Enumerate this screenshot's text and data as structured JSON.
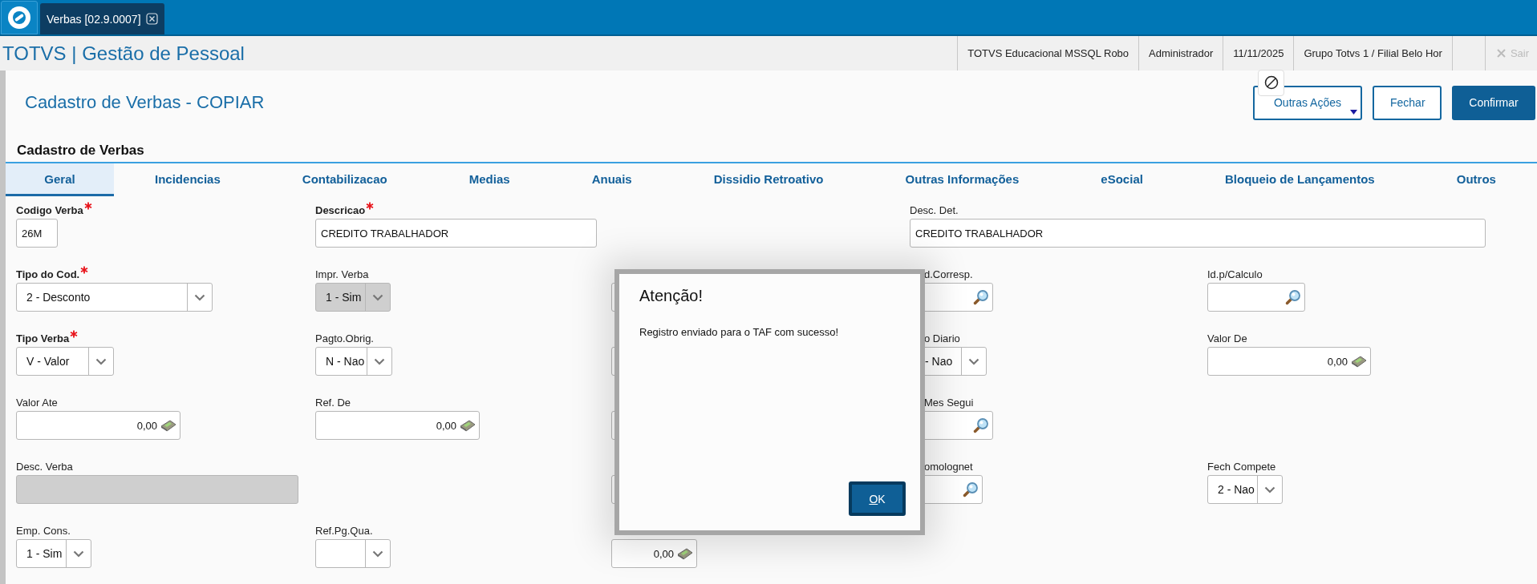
{
  "top_bar": {
    "open_tab": {
      "label": "Verbas [02.9.0007]"
    }
  },
  "header": {
    "title": "TOTVS | Gestão de Pessoal",
    "info": [
      "TOTVS Educacional MSSQL Robo",
      "Administrador",
      "11/11/2025",
      "Grupo Totvs 1 / Filial Belo Hor"
    ],
    "logout": {
      "label": "Sair",
      "disabled": true
    }
  },
  "page": {
    "title": "Cadastro de Verbas - COPIAR",
    "buttons": [
      {
        "label": "Outras Ações",
        "kind": "menu"
      },
      {
        "label": "Fechar",
        "kind": "secondary"
      },
      {
        "label": "Confirmar",
        "kind": "primary"
      }
    ]
  },
  "section": "Cadastro de Verbas",
  "tabs": [
    {
      "label": "Geral",
      "selected": true
    },
    {
      "label": "Incidencias",
      "selected": false
    },
    {
      "label": "Contabilizacao",
      "selected": false
    },
    {
      "label": "Medias",
      "selected": false
    },
    {
      "label": "Anuais",
      "selected": false
    },
    {
      "label": "Dissidio Retroativo",
      "selected": false
    },
    {
      "label": "Outras Informações",
      "selected": false
    },
    {
      "label": "eSocial",
      "selected": false
    },
    {
      "label": "Bloqueio de Lançamentos",
      "selected": false
    },
    {
      "label": "Outros",
      "selected": false
    }
  ],
  "form_rows": [
    [
      {
        "kind": "text",
        "label": "Codigo Verba",
        "required": true,
        "value": "26M"
      },
      {
        "kind": "text",
        "label": "Descricao",
        "required": true,
        "value": "CREDITO TRABALHADOR"
      },
      {
        "kind": "empty"
      },
      {
        "kind": "text",
        "label": "Desc. Det.",
        "required": false,
        "value": "CREDITO TRABALHADOR"
      }
    ],
    [
      {
        "kind": "select",
        "label": "Tipo do Cod.",
        "required": true,
        "value": "2 - Desconto",
        "disabled": false
      },
      {
        "kind": "select",
        "label": "Impr. Verba",
        "required": false,
        "value": "1 - Sim",
        "disabled": true
      },
      {
        "kind": "covered"
      },
      {
        "kind": "lookup",
        "label": "d.Corresp.",
        "required": false
      },
      {
        "kind": "lookup",
        "label": "Id.p/Calculo",
        "required": false
      }
    ],
    [
      {
        "kind": "select",
        "label": "Tipo Verba",
        "required": true,
        "value": "V - Valor",
        "disabled": false
      },
      {
        "kind": "select",
        "label": "Pagto.Obrig.",
        "required": false,
        "value": "N - Nao",
        "disabled": false
      },
      {
        "kind": "covered"
      },
      {
        "kind": "select",
        "label": "o Diario",
        "required": false,
        "value": "- Nao",
        "disabled": false
      },
      {
        "kind": "currency",
        "label": "Valor De",
        "required": false,
        "value": "0,00"
      }
    ],
    [
      {
        "kind": "currency",
        "label": "Valor Ate",
        "required": false,
        "value": "0,00"
      },
      {
        "kind": "currency",
        "label": "Ref. De",
        "required": false,
        "value": "0,00"
      },
      {
        "kind": "covered"
      },
      {
        "kind": "lookup",
        "label": "Mes Segui",
        "required": false
      },
      {
        "kind": "empty"
      }
    ],
    [
      {
        "kind": "text",
        "label": "Desc. Verba",
        "required": false,
        "disabled": true
      },
      {
        "kind": "empty"
      },
      {
        "kind": "covered"
      },
      {
        "kind": "lookup",
        "label": "omolognet",
        "required": false
      },
      {
        "kind": "select",
        "label": "Fech Compete",
        "required": false,
        "value": "2 - Nao",
        "disabled": false
      }
    ],
    [
      {
        "kind": "select",
        "label": "Emp. Cons.",
        "required": false,
        "value": "1 - Sim",
        "disabled": false
      },
      {
        "kind": "select",
        "label": "Ref.Pg.Qua.",
        "required": false,
        "disabled": false
      },
      {
        "kind": "currency",
        "value": "0,00"
      },
      {
        "kind": "empty"
      },
      {
        "kind": "empty"
      }
    ]
  ],
  "dialog": {
    "title": "Atenção!",
    "message": "Registro enviado para o TAF com sucesso!",
    "button": "OK"
  }
}
